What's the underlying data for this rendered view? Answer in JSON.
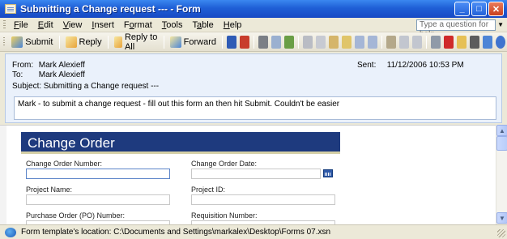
{
  "window": {
    "title": "Submitting a Change request --- - Form"
  },
  "menu": {
    "items": [
      {
        "pre": "",
        "ul": "F",
        "post": "ile"
      },
      {
        "pre": "",
        "ul": "E",
        "post": "dit"
      },
      {
        "pre": "",
        "ul": "V",
        "post": "iew"
      },
      {
        "pre": "",
        "ul": "I",
        "post": "nsert"
      },
      {
        "pre": "F",
        "ul": "o",
        "post": "rmat"
      },
      {
        "pre": "",
        "ul": "T",
        "post": "ools"
      },
      {
        "pre": "T",
        "ul": "a",
        "post": "ble"
      },
      {
        "pre": "",
        "ul": "H",
        "post": "elp"
      }
    ],
    "help_placeholder": "Type a question for help"
  },
  "toolbar": {
    "submit": "Submit",
    "reply": "Reply",
    "reply_all": "Reply to All",
    "forward": "Forward"
  },
  "header": {
    "from_label": "From:",
    "from_value": "Mark Alexieff",
    "to_label": "To:",
    "to_value": "Mark Alexieff",
    "subject_label": "Subject:",
    "subject_value": "Submitting a Change request ---",
    "sent_label": "Sent:",
    "sent_value": "11/12/2006 10:53 PM",
    "message": "Mark - to submit a change request - fill out this form an then hit Submit.  Couldn't be easier"
  },
  "form": {
    "title": "Change Order",
    "fields": {
      "change_order_number": "Change Order Number:",
      "change_order_date": "Change Order Date:",
      "project_name": "Project Name:",
      "project_id": "Project ID:",
      "purchase_order_number": "Purchase Order (PO) Number:",
      "requisition_number": "Requisition Number:"
    }
  },
  "status": {
    "text": "Form template's location: C:\\Documents and Settings\\markalex\\Desktop\\Forms 07.xsn"
  },
  "colors": {
    "titlebar": "#1f5fd6",
    "form_header": "#1e3a7e",
    "header_panel": "#eaf1fb"
  }
}
